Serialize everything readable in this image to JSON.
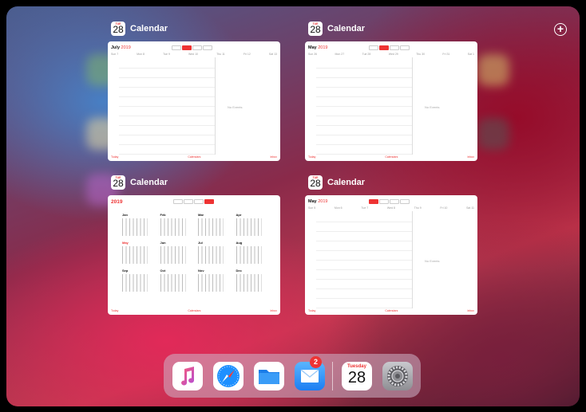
{
  "switcher": {
    "add_symbol": "+",
    "cards": [
      {
        "app": "Calendar",
        "icon_day": "28",
        "icon_month": "TUE",
        "title": "July",
        "year": "2019",
        "view": "week",
        "days": [
          "Sun 7",
          "Mon 8",
          "Tue 9",
          "Wed 10",
          "Thu 11",
          "Fri 12",
          "Sat 13"
        ],
        "side_text": "No Events",
        "bottom_left": "Today",
        "bottom_center": "Calendars",
        "bottom_right": "Inbox"
      },
      {
        "app": "Calendar",
        "icon_day": "28",
        "icon_month": "TUE",
        "title": "May",
        "year": "2019",
        "view": "week",
        "days": [
          "Sun 26",
          "Mon 27",
          "Tue 28",
          "Wed 29",
          "Thu 30",
          "Fri 31",
          "Sat 1"
        ],
        "side_text": "No Events",
        "bottom_left": "Today",
        "bottom_center": "Calendars",
        "bottom_right": "Inbox"
      },
      {
        "app": "Calendar",
        "icon_day": "28",
        "icon_month": "TUE",
        "title": "",
        "year": "2019",
        "view": "year",
        "months": [
          "Jan",
          "Feb",
          "Mar",
          "Apr",
          "May",
          "Jun",
          "Jul",
          "Aug",
          "Sep",
          "Oct",
          "Nov",
          "Dec"
        ],
        "bottom_left": "Today",
        "bottom_center": "Calendars",
        "bottom_right": "Inbox"
      },
      {
        "app": "Calendar",
        "icon_day": "28",
        "icon_month": "TUE",
        "title": "May",
        "year": "2019",
        "view": "week",
        "days": [
          "Sun 5",
          "Mon 6",
          "Tue 7",
          "Wed 8",
          "Thu 9",
          "Fri 10",
          "Sat 11"
        ],
        "side_text": "No Events",
        "bottom_left": "Today",
        "bottom_center": "Calendars",
        "bottom_right": "Inbox"
      }
    ]
  },
  "dock": {
    "apps": [
      {
        "name": "Music",
        "icon": "music-icon"
      },
      {
        "name": "Safari",
        "icon": "safari-icon"
      },
      {
        "name": "Files",
        "icon": "files-icon"
      },
      {
        "name": "Mail",
        "icon": "mail-icon",
        "badge": "2"
      },
      {
        "name": "Calendar",
        "icon": "calendar-icon",
        "weekday": "Tuesday",
        "day": "28"
      },
      {
        "name": "Settings",
        "icon": "settings-icon"
      }
    ]
  },
  "colors": {
    "accent": "#e33b3b",
    "mail": "#2f8ef0",
    "safari": "#1e90ff",
    "files": "#2a8ef5"
  }
}
